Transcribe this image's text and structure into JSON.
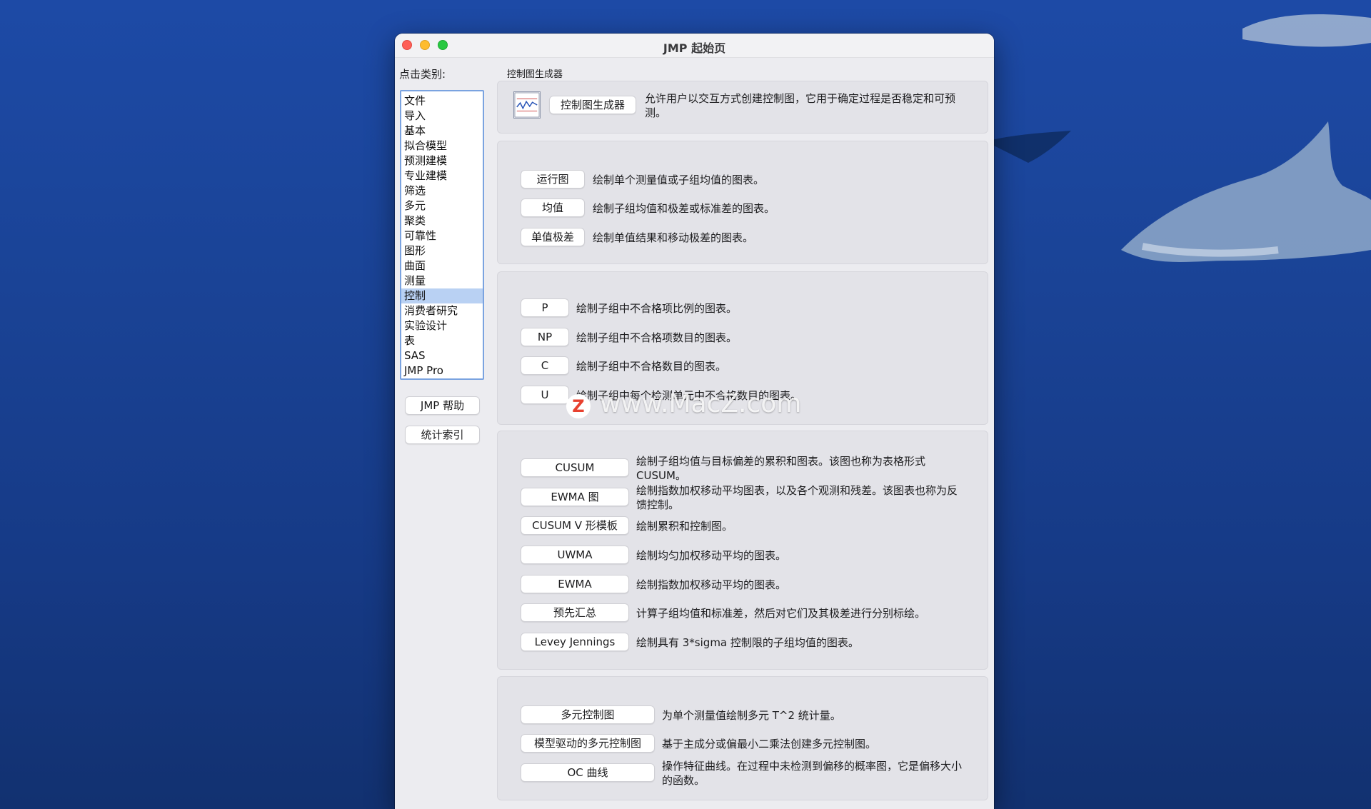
{
  "window": {
    "title": "JMP 起始页"
  },
  "sidebar": {
    "label": "点击类别:",
    "categories": [
      "文件",
      "导入",
      "基本",
      "拟合模型",
      "预测建模",
      "专业建模",
      "筛选",
      "多元",
      "聚类",
      "可靠性",
      "图形",
      "曲面",
      "测量",
      "控制",
      "消费者研究",
      "实验设计",
      "表",
      "SAS",
      "JMP Pro"
    ],
    "selected": "控制",
    "help_button": "JMP 帮助",
    "index_button": "统计索引"
  },
  "main": {
    "section_title": "控制图生成器",
    "builder": {
      "button": "控制图生成器",
      "desc": "允许用户以交互方式创建控制图，它用于确定过程是否稳定和可预测。"
    },
    "group1": [
      {
        "label": "运行图",
        "desc": "绘制单个测量值或子组均值的图表。"
      },
      {
        "label": "均值",
        "desc": "绘制子组均值和极差或标准差的图表。"
      },
      {
        "label": "单值极差",
        "desc": "绘制单值结果和移动极差的图表。"
      }
    ],
    "group2": [
      {
        "label": "P",
        "desc": "绘制子组中不合格项比例的图表。"
      },
      {
        "label": "NP",
        "desc": "绘制子组中不合格项数目的图表。"
      },
      {
        "label": "C",
        "desc": "绘制子组中不合格数目的图表。"
      },
      {
        "label": "U",
        "desc": "绘制子组中每个检测单元中不合格数目的图表。"
      }
    ],
    "group3": [
      {
        "label": "CUSUM",
        "desc": "绘制子组均值与目标偏差的累积和图表。该图也称为表格形式CUSUM。"
      },
      {
        "label": "EWMA 图",
        "desc": "绘制指数加权移动平均图表，以及各个观测和残差。该图表也称为反馈控制。"
      },
      {
        "label": "CUSUM V 形模板",
        "desc": "绘制累积和控制图。"
      },
      {
        "label": "UWMA",
        "desc": "绘制均匀加权移动平均的图表。"
      },
      {
        "label": "EWMA",
        "desc": "绘制指数加权移动平均的图表。"
      },
      {
        "label": "预先汇总",
        "desc": "计算子组均值和标准差，然后对它们及其极差进行分别标绘。"
      },
      {
        "label": "Levey Jennings",
        "desc": "绘制具有 3*sigma 控制限的子组均值的图表。"
      }
    ],
    "group4": [
      {
        "label": "多元控制图",
        "desc": "为单个测量值绘制多元 T^2 统计量。"
      },
      {
        "label": "模型驱动的多元控制图",
        "desc": "基于主成分或偏最小二乘法创建多元控制图。"
      },
      {
        "label": "OC 曲线",
        "desc": "操作特征曲线。在过程中未检测到偏移的概率图，它是偏移大小的函数。"
      }
    ]
  },
  "watermark": {
    "logo": "Z",
    "text": "www.MacZ.com"
  }
}
